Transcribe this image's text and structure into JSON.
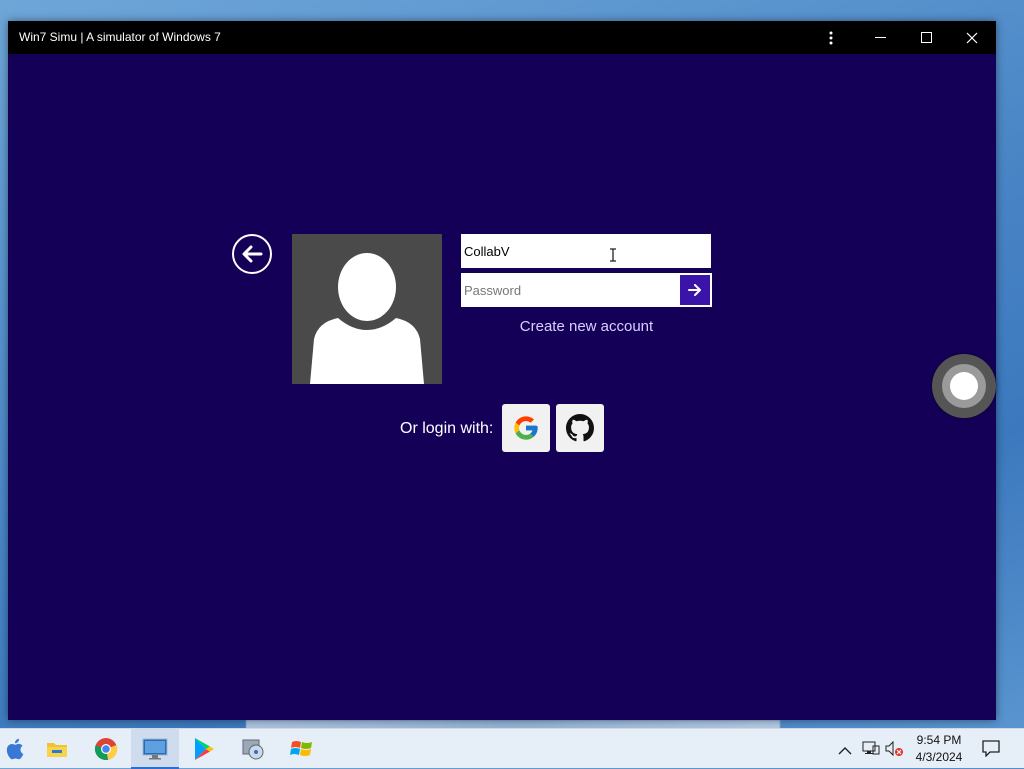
{
  "window": {
    "title": "Win7 Simu | A simulator of Windows 7"
  },
  "login": {
    "username_value": "CollabV",
    "password_placeholder": "Password",
    "create_account_label": "Create new account",
    "or_login_label": "Or login with:"
  },
  "taskbar": {
    "icons": [
      "apple-icon",
      "file-explorer-icon",
      "chrome-icon",
      "remote-desktop-icon",
      "play-store-icon",
      "media-player-icon",
      "windows-logo-icon"
    ],
    "active_icon": "remote-desktop-icon",
    "time": "9:54 PM",
    "date": "4/3/2024"
  },
  "colors": {
    "app_background": "#150058",
    "accent_button": "#3a14a8",
    "titlebar": "#000000"
  }
}
